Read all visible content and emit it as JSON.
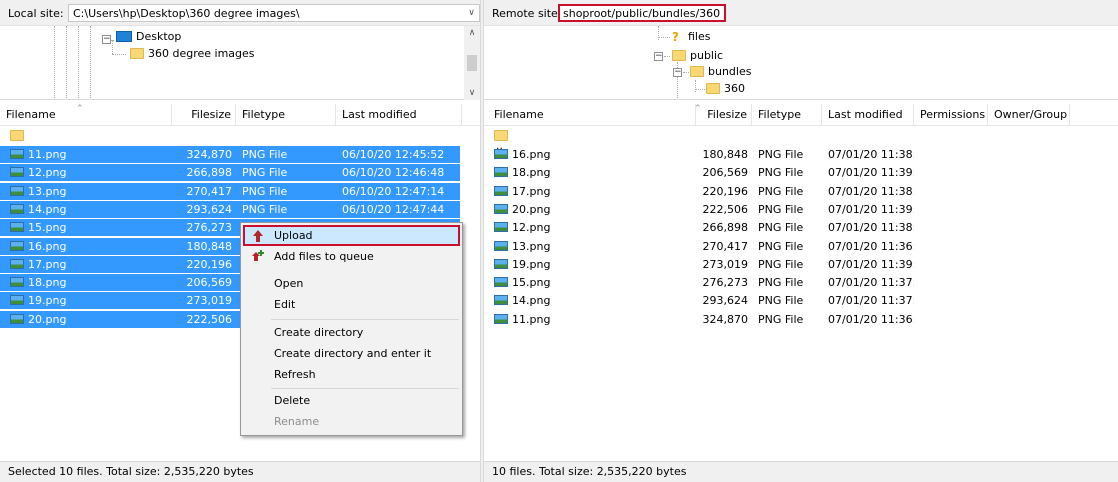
{
  "local": {
    "site_label": "Local site:",
    "path": "C:\\Users\\hp\\Desktop\\360 degree images\\",
    "tree": {
      "desktop": "Desktop",
      "child": "360 degree images"
    },
    "columns": {
      "filename": "Filename",
      "filesize": "Filesize",
      "filetype": "Filetype",
      "last_modified": "Last modified"
    },
    "parent_dir": "..",
    "files": [
      {
        "name": "11.png",
        "size": "324,870",
        "type": "PNG File",
        "modified": "06/10/20 12:45:52"
      },
      {
        "name": "12.png",
        "size": "266,898",
        "type": "PNG File",
        "modified": "06/10/20 12:46:48"
      },
      {
        "name": "13.png",
        "size": "270,417",
        "type": "PNG File",
        "modified": "06/10/20 12:47:14"
      },
      {
        "name": "14.png",
        "size": "293,624",
        "type": "PNG File",
        "modified": "06/10/20 12:47:44"
      },
      {
        "name": "15.png",
        "size": "276,273",
        "type": "",
        "modified": ""
      },
      {
        "name": "16.png",
        "size": "180,848",
        "type": "",
        "modified": ""
      },
      {
        "name": "17.png",
        "size": "220,196",
        "type": "",
        "modified": ""
      },
      {
        "name": "18.png",
        "size": "206,569",
        "type": "",
        "modified": ""
      },
      {
        "name": "19.png",
        "size": "273,019",
        "type": "",
        "modified": ""
      },
      {
        "name": "20.png",
        "size": "222,506",
        "type": "",
        "modified": ""
      }
    ],
    "status": "Selected 10 files. Total size: 2,535,220 bytes"
  },
  "remote": {
    "site_label": "Remote site:",
    "path": "shoproot/public/bundles/360",
    "tree": {
      "files": "files",
      "public": "public",
      "bundles": "bundles",
      "child": "360"
    },
    "columns": {
      "filename": "Filename",
      "filesize": "Filesize",
      "filetype": "Filetype",
      "last_modified": "Last modified",
      "permissions": "Permissions",
      "owner_group": "Owner/Group"
    },
    "parent_dir": "..",
    "files": [
      {
        "name": "16.png",
        "size": "180,848",
        "type": "PNG File",
        "modified": "07/01/20 11:38:..."
      },
      {
        "name": "18.png",
        "size": "206,569",
        "type": "PNG File",
        "modified": "07/01/20 11:39:..."
      },
      {
        "name": "17.png",
        "size": "220,196",
        "type": "PNG File",
        "modified": "07/01/20 11:38:..."
      },
      {
        "name": "20.png",
        "size": "222,506",
        "type": "PNG File",
        "modified": "07/01/20 11:39:..."
      },
      {
        "name": "12.png",
        "size": "266,898",
        "type": "PNG File",
        "modified": "07/01/20 11:38:..."
      },
      {
        "name": "13.png",
        "size": "270,417",
        "type": "PNG File",
        "modified": "07/01/20 11:36:..."
      },
      {
        "name": "19.png",
        "size": "273,019",
        "type": "PNG File",
        "modified": "07/01/20 11:39:..."
      },
      {
        "name": "15.png",
        "size": "276,273",
        "type": "PNG File",
        "modified": "07/01/20 11:37:..."
      },
      {
        "name": "14.png",
        "size": "293,624",
        "type": "PNG File",
        "modified": "07/01/20 11:37:..."
      },
      {
        "name": "11.png",
        "size": "324,870",
        "type": "PNG File",
        "modified": "07/01/20 11:36:..."
      }
    ],
    "status": "10 files. Total size: 2,535,220 bytes"
  },
  "context_menu": {
    "upload": "Upload",
    "add_to_queue": "Add files to queue",
    "open": "Open",
    "edit": "Edit",
    "create_directory": "Create directory",
    "create_directory_enter": "Create directory and enter it",
    "refresh": "Refresh",
    "delete": "Delete",
    "rename": "Rename"
  },
  "colors": {
    "selection": "#3399ff",
    "highlight_outline": "#c8102e",
    "menu_hover": "#cce8ff"
  }
}
